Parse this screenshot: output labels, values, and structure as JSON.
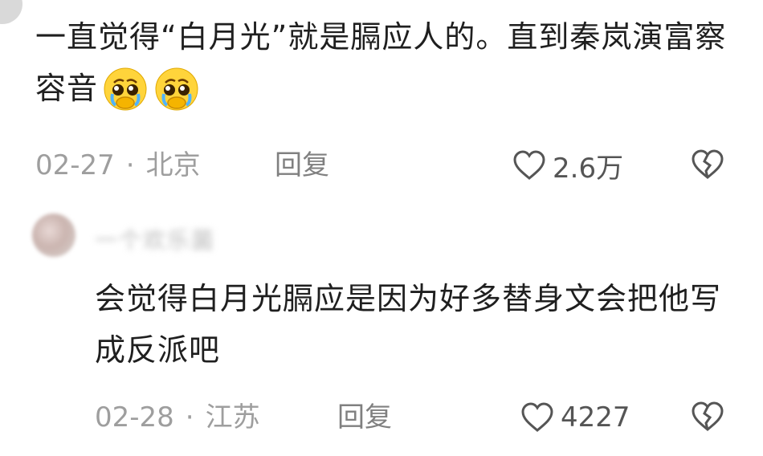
{
  "comment": {
    "text": "一直觉得“白月光”就是膈应人的。直到秦岚演富察容音",
    "date": "02-27",
    "location": "北京",
    "reply_label": "回复",
    "likes": "2.6万",
    "emojis": [
      "crying-face-emoji",
      "crying-face-emoji"
    ]
  },
  "reply": {
    "username": "一个欢乐菌",
    "text": "会觉得白月光膈应是因为好多替身文会把他写成反派吧",
    "date": "02-28",
    "location": "江苏",
    "reply_label": "回复",
    "likes": "4227"
  },
  "colors": {
    "meta": "#9e9e9e",
    "text": "#1f1f1f",
    "emoji": "#ffd43b"
  }
}
